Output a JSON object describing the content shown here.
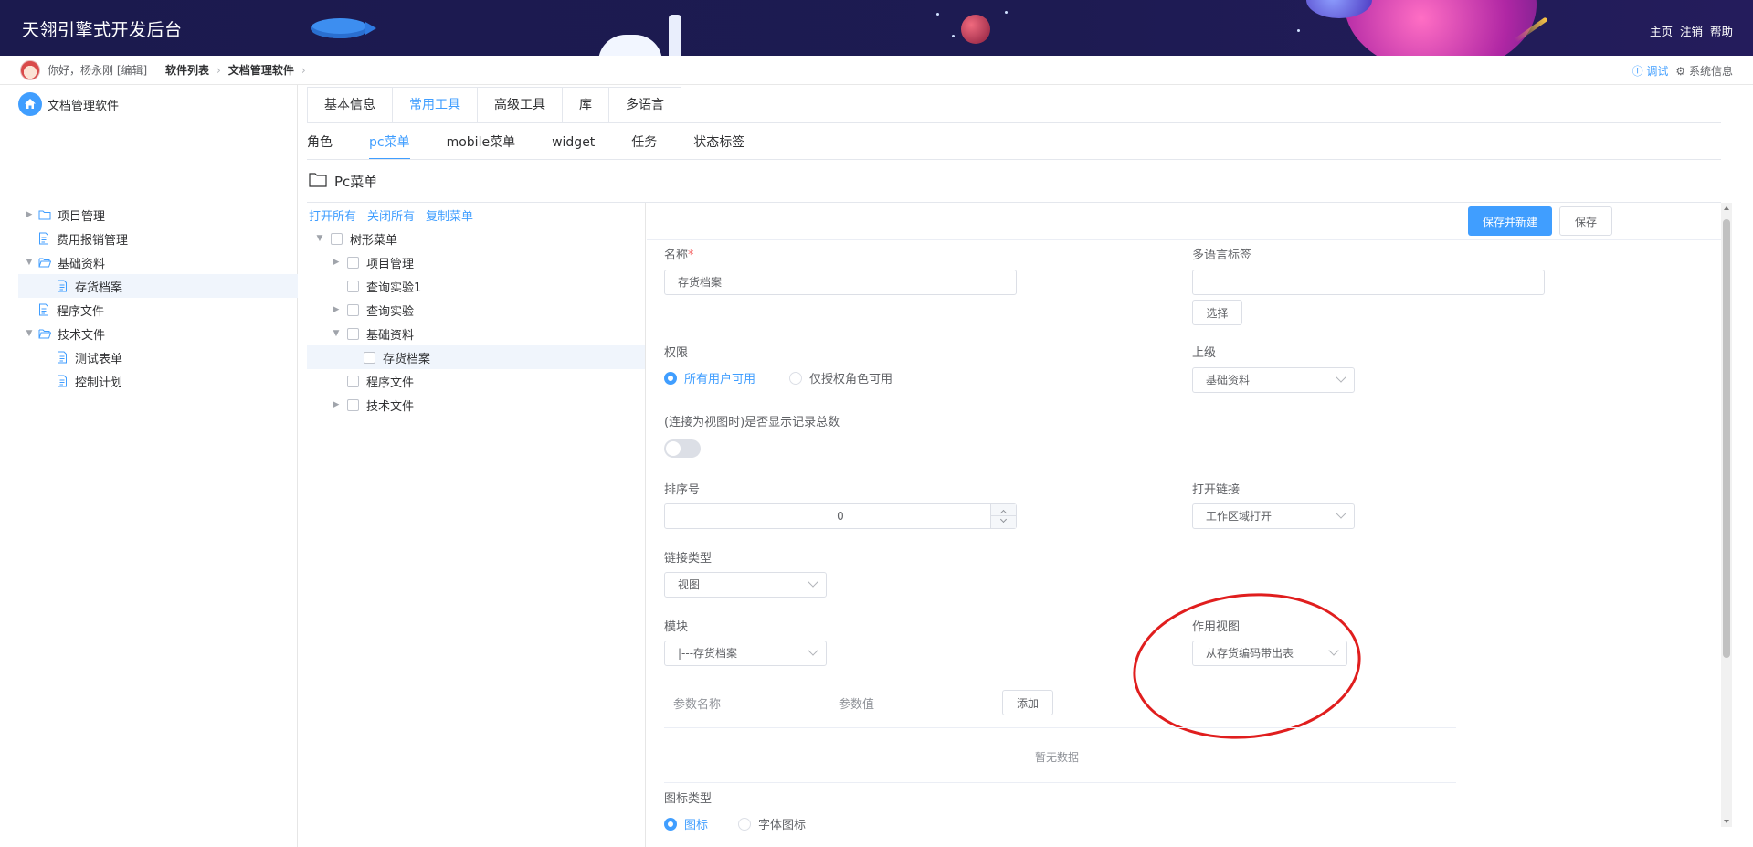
{
  "header": {
    "title": "天翎引擎式开发后台",
    "nav": [
      "主页",
      "注销",
      "帮助"
    ]
  },
  "breadcrumb": {
    "greeting": "你好，杨永刚 [编辑]",
    "items": [
      "软件列表",
      "文档管理软件"
    ],
    "debug": "ⓘ 调试",
    "system": "⚙ 系统信息"
  },
  "left_tree": {
    "root": "文档管理软件",
    "items": [
      {
        "label": "项目管理",
        "type": "folder",
        "expanded": false
      },
      {
        "label": "费用报销管理",
        "type": "doc"
      },
      {
        "label": "基础资料",
        "type": "folder",
        "expanded": true
      },
      {
        "label": "存货档案",
        "type": "doc",
        "selected": true
      },
      {
        "label": "程序文件",
        "type": "doc"
      },
      {
        "label": "技术文件",
        "type": "folder",
        "expanded": true
      },
      {
        "label": "测试表单",
        "type": "doc"
      },
      {
        "label": "控制计划",
        "type": "doc"
      }
    ]
  },
  "tabs_top": [
    "基本信息",
    "常用工具",
    "高级工具",
    "库",
    "多语言"
  ],
  "tabs_top_active": "常用工具",
  "tabs_sub": [
    "角色",
    "pc菜单",
    "mobile菜单",
    "widget",
    "任务",
    "状态标签"
  ],
  "tabs_sub_active": "pc菜单",
  "section_title": "Pc菜单",
  "mid_tree": {
    "actions": [
      "打开所有",
      "关闭所有",
      "复制菜单"
    ],
    "items": [
      "树形菜单",
      "项目管理",
      "查询实验1",
      "查询实验",
      "基础资料",
      "存货档案",
      "程序文件",
      "技术文件"
    ]
  },
  "form": {
    "save_new": "保存并新建",
    "save": "保存",
    "name_label": "名称",
    "name_required": "*",
    "name_value": "存货档案",
    "i18n_label": "多语言标签",
    "i18n_value": "",
    "choose": "选择",
    "perm_label": "权限",
    "perm_all": "所有用户可用",
    "perm_role": "仅授权角色可用",
    "parent_label": "上级",
    "parent_value": "基础资料",
    "show_count_label": "(连接为视图时)是否显示记录总数",
    "order_label": "排序号",
    "order_value": "0",
    "open_link_label": "打开链接",
    "open_link_value": "工作区域打开",
    "link_type_label": "链接类型",
    "link_type_value": "视图",
    "module_label": "模块",
    "module_value": "|---存货档案",
    "view_label": "作用视图",
    "view_value": "从存货编码带出表",
    "param_name": "参数名称",
    "param_value": "参数值",
    "add": "添加",
    "empty": "暂无数据",
    "icon_type_label": "图标类型",
    "icon_img": "图标",
    "icon_font": "字体图标"
  },
  "colors": {
    "primary": "#409eff",
    "header_bg": "#1b1a4e",
    "annotation": "#e01e1e"
  }
}
